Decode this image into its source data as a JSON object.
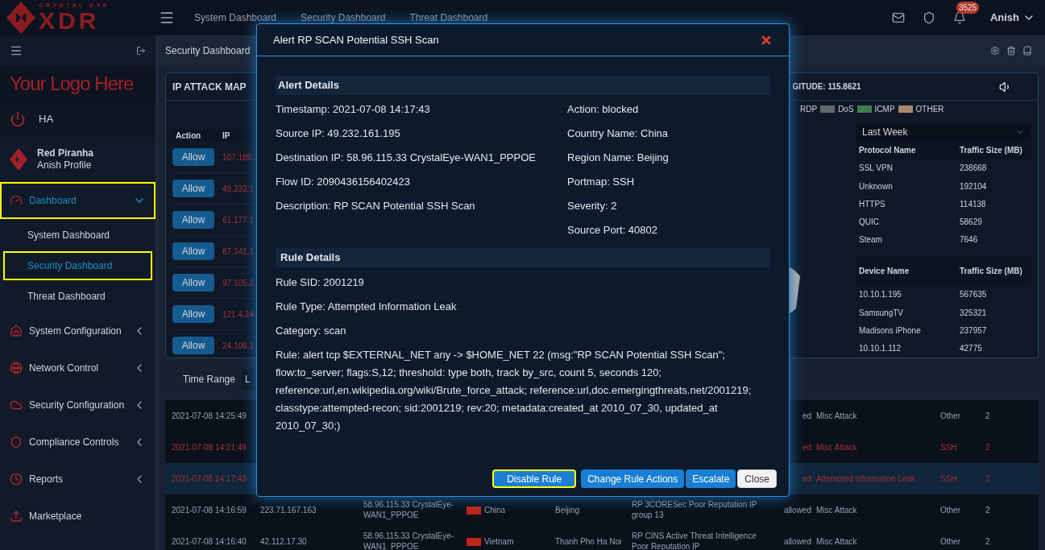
{
  "header": {
    "logo_top": "CRYSTAL EYE",
    "logo_main": "XDR",
    "nav": [
      "System Dashboard",
      "Security Dashboard",
      "Threat Dashboard"
    ],
    "notification_count": "3525",
    "user": "Anish"
  },
  "sidebar": {
    "logo_text": "Your Logo Here",
    "ha": "HA",
    "profile": {
      "name": "Red Piranha",
      "sub": "Anish Profile"
    },
    "items": [
      {
        "label": "Dashboard",
        "kind": "group",
        "expanded": true,
        "selected": true,
        "highlighted": true,
        "children": [
          {
            "label": "System Dashboard",
            "selected": false,
            "highlighted": false
          },
          {
            "label": "Security Dashboard",
            "selected": true,
            "highlighted": true
          },
          {
            "label": "Threat Dashboard",
            "selected": false,
            "highlighted": false
          }
        ]
      },
      {
        "label": "System Configuration",
        "kind": "group",
        "expanded": false,
        "selected": false,
        "highlighted": false
      },
      {
        "label": "Network Control",
        "kind": "group",
        "expanded": false,
        "selected": false,
        "highlighted": false
      },
      {
        "label": "Security Configuration",
        "kind": "group",
        "expanded": false,
        "selected": false,
        "highlighted": false
      },
      {
        "label": "Compliance Controls",
        "kind": "group",
        "expanded": false,
        "selected": false,
        "highlighted": false
      },
      {
        "label": "Reports",
        "kind": "group",
        "expanded": false,
        "selected": false,
        "highlighted": false
      },
      {
        "label": "Marketplace",
        "kind": "link",
        "selected": false,
        "highlighted": false
      }
    ]
  },
  "breadcrumb": "Security Dashboard",
  "map_panel": {
    "title": "IP ATTACK MAP",
    "info": "GITUDE: 115.8621",
    "legend": [
      {
        "label": "RDP",
        "color": "#5f6b6b"
      },
      {
        "label": "DoS",
        "color": "#3f7f4f"
      },
      {
        "label": "ICMP",
        "color": "#a8876a"
      },
      {
        "label": "OTHER"
      }
    ],
    "attack_table": {
      "columns": [
        "Action",
        "IP"
      ],
      "rows": [
        {
          "action": "Allow",
          "ip": "107.189."
        },
        {
          "action": "Allow",
          "ip": "49.232.1"
        },
        {
          "action": "Allow",
          "ip": "61.177.1"
        },
        {
          "action": "Allow",
          "ip": "87.241.1"
        },
        {
          "action": "Allow",
          "ip": "97.105.2"
        },
        {
          "action": "Allow",
          "ip": "121.4.24"
        },
        {
          "action": "Allow",
          "ip": "24.106.1"
        }
      ]
    },
    "period": "Last Week",
    "protocol_table": {
      "columns": [
        "Protocol Name",
        "Traffic Size (MB)"
      ],
      "rows": [
        [
          "SSL VPN",
          "238668"
        ],
        [
          "Unknown",
          "192104"
        ],
        [
          "HTTPS",
          "114138"
        ],
        [
          "QUIC",
          "58629"
        ],
        [
          "Steam",
          "7646"
        ]
      ]
    },
    "device_table": {
      "columns": [
        "Device Name",
        "Traffic Size (MB)"
      ],
      "rows": [
        [
          "10.10.1.195",
          "567635"
        ],
        [
          "SamsungTV",
          "325321"
        ],
        [
          "Madisons iPhone",
          "237957"
        ],
        [
          "10.10.1.112",
          "42775"
        ]
      ]
    }
  },
  "time_range": {
    "label": "Time Range",
    "value": "L"
  },
  "events": [
    {
      "time": "2021-07-08 14:25:49",
      "status": "ed",
      "category": "Misc Attack",
      "protocol": "Other",
      "count": "2",
      "alert": false,
      "selected": false
    },
    {
      "time": "2021-07-08 14:21:49",
      "status": "ed",
      "category": "Misc Attack",
      "protocol": "SSH",
      "count": "2",
      "alert": true,
      "selected": false
    },
    {
      "time": "2021-07-08 14:17:43",
      "status": "ed",
      "category": "Attempted Information Leak",
      "protocol": "SSH",
      "count": "2",
      "alert": true,
      "selected": true
    },
    {
      "time": "2021-07-08 14:16:59",
      "source": "223.71.167.163",
      "destination": "58.96.115.33 CrystalEye-WAN1_PPPOE",
      "country": "China",
      "region": "Beijing",
      "rule": "RP 3CORESec Poor Reputation IP group 13",
      "status": "allowed",
      "category": "Misc Attack",
      "protocol": "Other",
      "count": "2",
      "alert": false,
      "selected": false
    },
    {
      "time": "2021-07-08 14:16:40",
      "source": "42.112.17.30",
      "destination": "58.96.115.33 CrystalEye-WAN1_PPPOE",
      "country": "Vietnam",
      "region": "Thanh Pho Ha Noi",
      "rule": "RP CINS Active Threat Intelligence Poor Reputation IP",
      "status": "allowed",
      "category": "Misc Attack",
      "protocol": "Other",
      "count": "2",
      "alert": false,
      "selected": false
    }
  ],
  "modal": {
    "title": "Alert RP SCAN Potential SSH Scan",
    "alert_heading": "Alert Details",
    "alert_left": [
      "Timestamp: 2021-07-08 14:17:43",
      "Source IP: 49.232.161.195",
      "Destination IP: 58.96.115.33 CrystalEye-WAN1_PPPOE",
      "Flow ID: 2090436156402423",
      "Description: RP SCAN Potential SSH Scan"
    ],
    "alert_right": [
      "Action: blocked",
      "Country Name: China",
      "Region Name: Beijing",
      "Portmap: SSH",
      "Severity: 2",
      "Source Port: 40802"
    ],
    "rule_heading": "Rule Details",
    "rule_fields": [
      "Rule SID: 2001219",
      "Rule Type: Attempted Information Leak",
      "Category: scan",
      "Rule: alert tcp $EXTERNAL_NET any -> $HOME_NET 22 (msg:\"RP SCAN Potential SSH Scan\"; flow:to_server; flags:S,12; threshold: type both, track by_src, count 5, seconds 120; reference:url,en.wikipedia.org/wiki/Brute_force_attack; reference:url,doc.emergingthreats.net/2001219; classtype:attempted-recon; sid:2001219; rev:20; metadata:created_at 2010_07_30, updated_at 2010_07_30;)"
    ],
    "buttons": [
      {
        "label": "Disable Rule",
        "kind": "primary",
        "highlighted": true
      },
      {
        "label": "Change Rule Actions",
        "kind": "primary",
        "highlighted": false
      },
      {
        "label": "Escalate",
        "kind": "primary",
        "highlighted": false
      },
      {
        "label": "Close",
        "kind": "secondary",
        "highlighted": false
      }
    ]
  }
}
